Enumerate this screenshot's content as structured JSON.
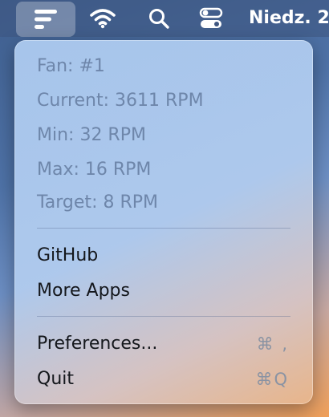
{
  "menubar": {
    "app_icon": "fan-app-icon",
    "wifi_icon": "wifi-icon",
    "search_icon": "search-icon",
    "control_center_icon": "control-center-icon",
    "clock": "Niedz. 2"
  },
  "menu": {
    "info": {
      "fan": "Fan: #1",
      "current": "Current: 3611 RPM",
      "min": "Min: 32 RPM",
      "max": "Max: 16 RPM",
      "target": "Target: 8 RPM"
    },
    "links": {
      "github": "GitHub",
      "more_apps": "More Apps"
    },
    "actions": {
      "preferences": "Preferences...",
      "preferences_shortcut": "⌘ ,",
      "quit": "Quit",
      "quit_shortcut": "⌘Q"
    }
  },
  "colors": {
    "info_text": "#6e86aa",
    "action_text": "#14171c",
    "shortcut_text": "#8a93a3"
  }
}
